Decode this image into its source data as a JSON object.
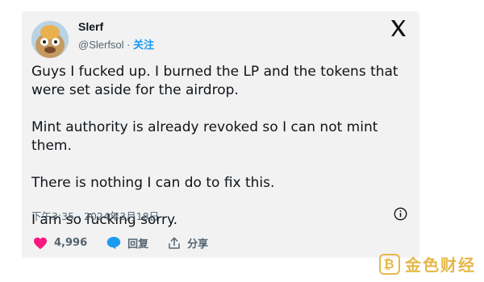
{
  "author": {
    "name": "Slerf",
    "handle": "@Slerfsol",
    "separator": "·",
    "follow_label": "关注"
  },
  "tweet": {
    "paragraphs": [
      "Guys I fucked up. I burned the LP and the tokens that were set aside for the airdrop.",
      "Mint authority is already revoked so I can not mint them.",
      "There is nothing I can do to fix this.",
      "I am so fucking sorry."
    ],
    "timestamp": "下午3:35 · 2024年3月18日"
  },
  "actions": {
    "likes": "4,996",
    "reply_label": "回复",
    "share_label": "分享"
  },
  "watermark": {
    "text": "金色财经"
  },
  "colors": {
    "like": "#f91880",
    "reply": "#1d9bf0",
    "follow": "#1d9bf0",
    "watermark": "#e6b84a"
  }
}
